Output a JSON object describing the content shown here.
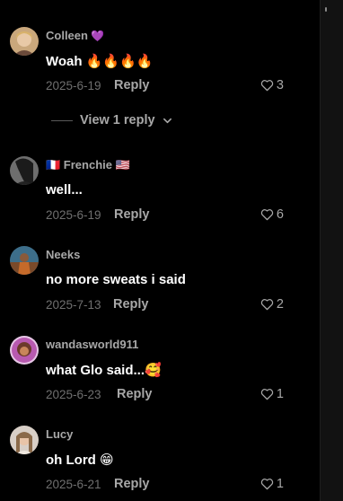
{
  "comments": [
    {
      "name": "Colleen",
      "name_emoji": "💜",
      "text": "Woah 🔥🔥🔥🔥",
      "date": "2025-6-19",
      "reply_label": "Reply",
      "likes": "3"
    },
    {
      "name": "🇫🇷 Frenchie 🇺🇸",
      "name_emoji": "",
      "text": "well...",
      "date": "2025-6-19",
      "reply_label": "Reply",
      "likes": "6"
    },
    {
      "name": "Neeks",
      "name_emoji": "",
      "text": "no more sweats i said",
      "date": "2025-7-13",
      "reply_label": "Reply",
      "likes": "2"
    },
    {
      "name": "wandasworld911",
      "name_emoji": "",
      "text": "what Glo said...🥰",
      "date": "2025-6-23",
      "reply_label": "Reply",
      "likes": "1"
    },
    {
      "name": "Lucy",
      "name_emoji": "",
      "text": "oh Lord 😁",
      "date": "2025-6-21",
      "reply_label": "Reply",
      "likes": "1"
    }
  ],
  "view_replies": {
    "label": "View 1 reply"
  },
  "icons": {
    "like": "heart-outline-icon",
    "expand": "chevron-down-icon"
  },
  "colors": {
    "background": "#000000",
    "secondary_text": "#a8a8a8",
    "date_text": "#6f6f6f"
  }
}
